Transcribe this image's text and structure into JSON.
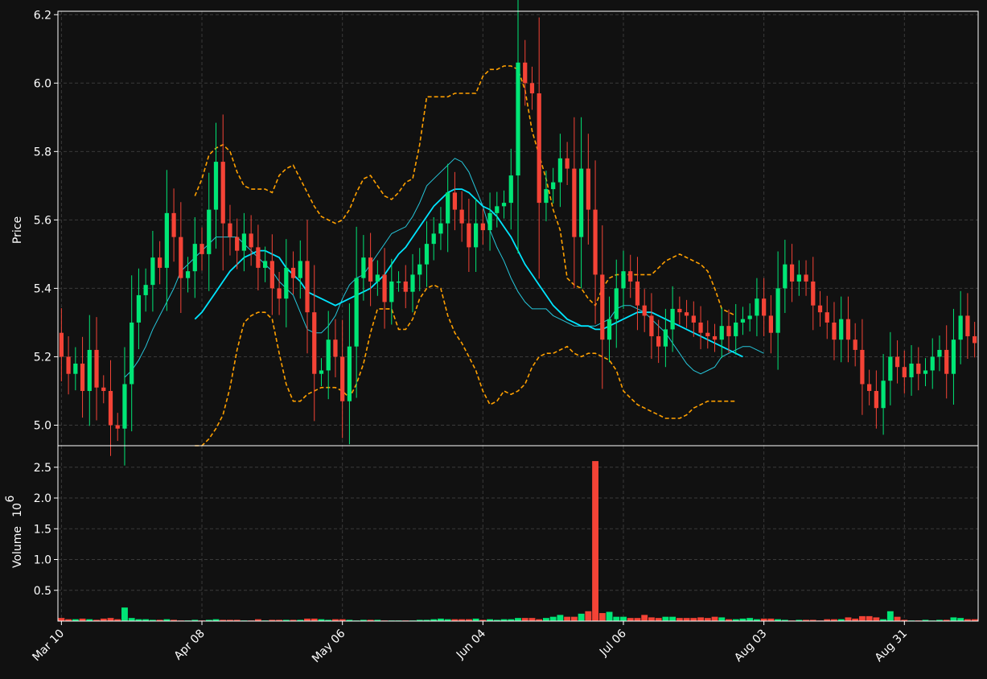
{
  "chart_data": {
    "type": "candlestick",
    "ylabel_price": "Price",
    "ylabel_volume": "Volume",
    "volume_exponent_label": "10",
    "volume_exponent": "6",
    "x_tick_labels": [
      "Mar 10",
      "Apr 08",
      "May 06",
      "Jun 04",
      "Jul 06",
      "Aug 03",
      "Aug 31"
    ],
    "x_tick_index": [
      0,
      20,
      40,
      60,
      80,
      100,
      120
    ],
    "price_ylim": [
      4.94,
      6.21
    ],
    "price_ticks": [
      "5.0",
      "5.2",
      "5.4",
      "5.6",
      "5.8",
      "6.0",
      "6.2"
    ],
    "price_tick_values": [
      5.0,
      5.2,
      5.4,
      5.6,
      5.8,
      6.0,
      6.2
    ],
    "volume_ylim": [
      0,
      2.85
    ],
    "volume_ticks": [
      "0.5",
      "1.0",
      "1.5",
      "2.0",
      "2.5"
    ],
    "volume_tick_values": [
      0.5,
      1.0,
      1.5,
      2.0,
      2.5
    ],
    "grid": true,
    "colors": {
      "up": "#00e676",
      "down": "#f44336",
      "ma_fast": "#26c6da",
      "ma_slow": "#00e5ff",
      "bands": "#ffa000",
      "background": "#111111",
      "axis": "#ffffff"
    },
    "series": [
      {
        "name": "close",
        "values": [
          5.2,
          5.15,
          5.18,
          5.1,
          5.22,
          5.11,
          5.1,
          5.0,
          4.99,
          5.12,
          5.3,
          5.38,
          5.41,
          5.49,
          5.46,
          5.62,
          5.55,
          5.43,
          5.45,
          5.53,
          5.5,
          5.63,
          5.77,
          5.59,
          5.55,
          5.51,
          5.56,
          5.52,
          5.46,
          5.48,
          5.4,
          5.37,
          5.46,
          5.43,
          5.48,
          5.33,
          5.15,
          5.16,
          5.25,
          5.2,
          5.07,
          5.23,
          5.43,
          5.49,
          5.42,
          5.44,
          5.36,
          5.42,
          5.42,
          5.39,
          5.44,
          5.47,
          5.53,
          5.56,
          5.59,
          5.68,
          5.63,
          5.59,
          5.52,
          5.59,
          5.57,
          5.62,
          5.64,
          5.65,
          5.73,
          6.06,
          6.0,
          5.97,
          5.65,
          5.69,
          5.71,
          5.78,
          5.75,
          5.55,
          5.75,
          5.63,
          5.44,
          5.25,
          5.31,
          5.4,
          5.45,
          5.42,
          5.35,
          5.32,
          5.26,
          5.23,
          5.28,
          5.34,
          5.33,
          5.32,
          5.3,
          5.27,
          5.26,
          5.25,
          5.29,
          5.26,
          5.3,
          5.31,
          5.32,
          5.37,
          5.32,
          5.27,
          5.4,
          5.47,
          5.42,
          5.44,
          5.42,
          5.35,
          5.33,
          5.3,
          5.25,
          5.31,
          5.25,
          5.22,
          5.12,
          5.1,
          5.05,
          5.13,
          5.2,
          5.17,
          5.14,
          5.18,
          5.15,
          5.16,
          5.2,
          5.22,
          5.15,
          5.25,
          5.32,
          5.26,
          5.24
        ]
      },
      {
        "name": "volume_millions",
        "values": [
          0.05,
          0.03,
          0.03,
          0.04,
          0.03,
          0.02,
          0.04,
          0.05,
          0.03,
          0.22,
          0.05,
          0.03,
          0.03,
          0.02,
          0.02,
          0.03,
          0.02,
          0.01,
          0.01,
          0.02,
          0.01,
          0.02,
          0.03,
          0.02,
          0.02,
          0.02,
          0.01,
          0.01,
          0.03,
          0.01,
          0.02,
          0.02,
          0.02,
          0.02,
          0.02,
          0.04,
          0.04,
          0.03,
          0.02,
          0.03,
          0.03,
          0.02,
          0.01,
          0.02,
          0.02,
          0.02,
          0.01,
          0.01,
          0.01,
          0.01,
          0.01,
          0.02,
          0.02,
          0.03,
          0.04,
          0.03,
          0.03,
          0.03,
          0.03,
          0.04,
          0.02,
          0.03,
          0.02,
          0.03,
          0.03,
          0.05,
          0.05,
          0.05,
          0.03,
          0.05,
          0.07,
          0.1,
          0.07,
          0.07,
          0.12,
          0.16,
          2.6,
          0.13,
          0.15,
          0.07,
          0.07,
          0.05,
          0.05,
          0.1,
          0.06,
          0.05,
          0.07,
          0.07,
          0.05,
          0.05,
          0.05,
          0.06,
          0.05,
          0.07,
          0.06,
          0.03,
          0.03,
          0.04,
          0.05,
          0.03,
          0.04,
          0.04,
          0.03,
          0.02,
          0.01,
          0.02,
          0.02,
          0.02,
          0.01,
          0.03,
          0.03,
          0.03,
          0.06,
          0.04,
          0.08,
          0.08,
          0.06,
          0.03,
          0.16,
          0.07,
          0.02,
          0.01,
          0.01,
          0.02,
          0.01,
          0.02,
          0.02,
          0.06,
          0.05,
          0.03,
          0.03
        ]
      },
      {
        "name": "ma_fast",
        "values": [
          null,
          null,
          null,
          null,
          null,
          null,
          null,
          null,
          null,
          5.14,
          5.16,
          5.19,
          5.23,
          5.28,
          5.32,
          5.36,
          5.4,
          5.45,
          5.47,
          5.49,
          5.51,
          5.53,
          5.55,
          5.55,
          5.55,
          5.55,
          5.53,
          5.51,
          5.49,
          5.47,
          5.45,
          5.42,
          5.4,
          5.38,
          5.33,
          5.28,
          5.27,
          5.27,
          5.29,
          5.32,
          5.37,
          5.41,
          5.43,
          5.44,
          5.47,
          5.5,
          5.53,
          5.56,
          5.57,
          5.58,
          5.61,
          5.65,
          5.7,
          5.72,
          5.74,
          5.76,
          5.78,
          5.77,
          5.74,
          5.69,
          5.64,
          5.57,
          5.52,
          5.48,
          5.43,
          5.39,
          5.36,
          5.34,
          5.34,
          5.34,
          5.32,
          5.31,
          5.3,
          5.29,
          5.29,
          5.29,
          5.29,
          5.3,
          5.31,
          5.34,
          5.35,
          5.35,
          5.34,
          5.33,
          5.31,
          5.29,
          5.27,
          5.24,
          5.21,
          5.18,
          5.16,
          5.15,
          5.16,
          5.17,
          5.2,
          5.21,
          5.22,
          5.23,
          5.23,
          5.22,
          5.21
        ]
      },
      {
        "name": "ma_slow",
        "values": [
          null,
          null,
          null,
          null,
          null,
          null,
          null,
          null,
          null,
          null,
          null,
          null,
          null,
          null,
          null,
          null,
          null,
          null,
          null,
          5.31,
          5.33,
          5.36,
          5.39,
          5.42,
          5.45,
          5.47,
          5.49,
          5.5,
          5.51,
          5.51,
          5.5,
          5.49,
          5.46,
          5.44,
          5.42,
          5.39,
          5.38,
          5.37,
          5.36,
          5.35,
          5.36,
          5.37,
          5.38,
          5.39,
          5.4,
          5.42,
          5.44,
          5.47,
          5.5,
          5.52,
          5.55,
          5.58,
          5.61,
          5.64,
          5.66,
          5.68,
          5.69,
          5.69,
          5.68,
          5.66,
          5.64,
          5.63,
          5.61,
          5.58,
          5.55,
          5.51,
          5.47,
          5.44,
          5.41,
          5.38,
          5.35,
          5.33,
          5.31,
          5.3,
          5.29,
          5.29,
          5.28,
          5.28,
          5.29,
          5.3,
          5.31,
          5.32,
          5.33,
          5.33,
          5.33,
          5.32,
          5.31,
          5.3,
          5.29,
          5.28,
          5.27,
          5.26,
          5.25,
          5.24,
          5.23,
          5.22,
          5.21,
          5.2
        ]
      },
      {
        "name": "upper_band",
        "values": [
          null,
          null,
          null,
          null,
          null,
          null,
          null,
          null,
          null,
          null,
          null,
          null,
          null,
          null,
          null,
          null,
          null,
          null,
          null,
          5.67,
          5.72,
          5.79,
          5.81,
          5.82,
          5.8,
          5.74,
          5.7,
          5.69,
          5.69,
          5.69,
          5.68,
          5.73,
          5.75,
          5.76,
          5.72,
          5.68,
          5.64,
          5.61,
          5.6,
          5.59,
          5.6,
          5.63,
          5.68,
          5.72,
          5.73,
          5.7,
          5.67,
          5.66,
          5.68,
          5.71,
          5.72,
          5.82,
          5.96,
          5.96,
          5.96,
          5.96,
          5.97,
          5.97,
          5.97,
          5.97,
          6.02,
          6.04,
          6.04,
          6.05,
          6.05,
          6.04,
          5.98,
          5.86,
          5.79,
          5.72,
          5.63,
          5.57,
          5.43,
          5.41,
          5.4,
          5.37,
          5.35,
          5.4,
          5.43,
          5.44,
          5.44,
          5.44,
          5.44,
          5.44,
          5.44,
          5.46,
          5.48,
          5.49,
          5.5,
          5.49,
          5.48,
          5.47,
          5.45,
          5.4,
          5.34,
          5.33,
          5.32
        ]
      },
      {
        "name": "lower_band",
        "values": [
          null,
          null,
          null,
          null,
          null,
          null,
          null,
          null,
          null,
          null,
          null,
          null,
          null,
          null,
          null,
          null,
          null,
          null,
          null,
          4.92,
          4.94,
          4.96,
          4.99,
          5.03,
          5.11,
          5.22,
          5.3,
          5.32,
          5.33,
          5.33,
          5.31,
          5.21,
          5.12,
          5.07,
          5.07,
          5.09,
          5.1,
          5.11,
          5.11,
          5.11,
          5.1,
          5.08,
          5.12,
          5.18,
          5.27,
          5.34,
          5.34,
          5.34,
          5.28,
          5.28,
          5.31,
          5.37,
          5.4,
          5.41,
          5.4,
          5.32,
          5.27,
          5.24,
          5.2,
          5.16,
          5.1,
          5.06,
          5.07,
          5.1,
          5.09,
          5.1,
          5.12,
          5.17,
          5.2,
          5.21,
          5.21,
          5.22,
          5.23,
          5.21,
          5.2,
          5.21,
          5.21,
          5.2,
          5.19,
          5.16,
          5.1,
          5.08,
          5.06,
          5.05,
          5.04,
          5.03,
          5.02,
          5.02,
          5.02,
          5.03,
          5.05,
          5.06,
          5.07,
          5.07,
          5.07,
          5.07,
          5.07
        ]
      }
    ]
  }
}
